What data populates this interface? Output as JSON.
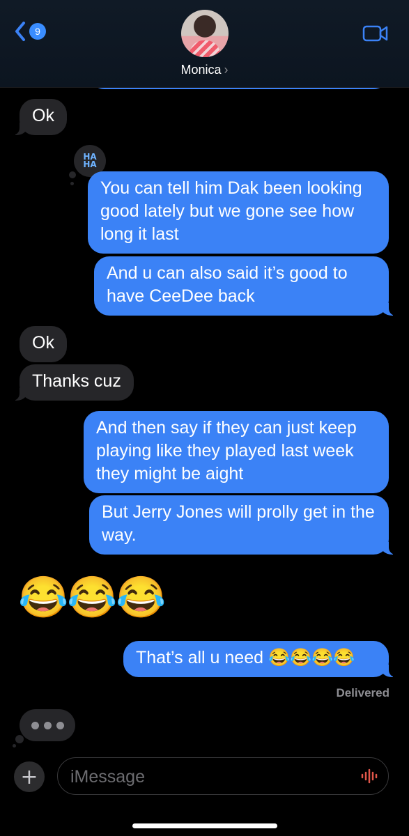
{
  "header": {
    "back_count": "9",
    "contact_name": "Monica",
    "back_icon": "chevron-left-icon",
    "video_icon": "video-camera-icon",
    "accent_color": "#3b82f6"
  },
  "messages": [
    {
      "id": "m1",
      "side": "in",
      "text": "Ok"
    },
    {
      "id": "m2",
      "side": "out",
      "text": "You can tell him Dak been looking good lately but we gone see how long it last",
      "tapback": "HA HA"
    },
    {
      "id": "m3",
      "side": "out",
      "text": "And u can also said it’s good to have CeeDee back"
    },
    {
      "id": "m4",
      "side": "in",
      "text": "Ok"
    },
    {
      "id": "m5",
      "side": "in",
      "text": "Thanks cuz"
    },
    {
      "id": "m6",
      "side": "out",
      "text": "And then say if they can just keep playing like they played last week they might be aight"
    },
    {
      "id": "m7",
      "side": "out",
      "text": "But Jerry Jones will prolly get in the way."
    },
    {
      "id": "m8",
      "side": "in",
      "text": "😂😂😂"
    },
    {
      "id": "m9",
      "side": "out",
      "text": "That’s all u need 😂😂😂😂"
    }
  ],
  "tapback": {
    "line1": "HA",
    "line2": "HA"
  },
  "status": {
    "delivered": "Delivered"
  },
  "composer": {
    "placeholder": "iMessage",
    "plus_label": "+"
  }
}
